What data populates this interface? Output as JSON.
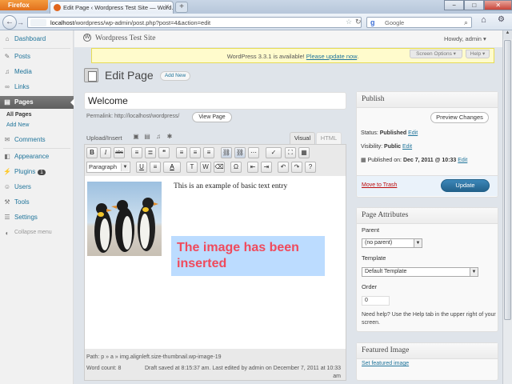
{
  "browser": {
    "menu_button": "Firefox",
    "tab_title": "Edit Page ‹ Wordpress Test Site — Word...",
    "url_host": "localhost",
    "url_path": "/wordpress/wp-admin/post.php?post=4&action=edit",
    "search_placeholder": "Google",
    "search_engine_glyph": "g",
    "win_min": "−",
    "win_max": "□",
    "win_close": "✕",
    "newtab": "+"
  },
  "wp_header": {
    "site_name": "Wordpress Test Site",
    "howdy": "Howdy, admin ▾",
    "update_nag_prefix": "WordPress 3.3.1 is available! ",
    "update_nag_link": "Please update now",
    "update_nag_suffix": ".",
    "screen_options": "Screen Options ▾",
    "help": "Help ▾"
  },
  "menu": {
    "dashboard": "Dashboard",
    "posts": "Posts",
    "media": "Media",
    "links": "Links",
    "pages": "Pages",
    "all_pages": "All Pages",
    "add_new": "Add New",
    "comments": "Comments",
    "appearance": "Appearance",
    "plugins": "Plugins",
    "plugins_badge": "1",
    "users": "Users",
    "tools": "Tools",
    "settings": "Settings",
    "collapse": "Collapse menu"
  },
  "page": {
    "heading": "Edit Page",
    "add_new_button": "Add New",
    "title_value": "Welcome",
    "permalink_label": "Permalink: http://localhost/wordpress/",
    "view_page_button": "View Page",
    "upload_insert_label": "Upload/Insert"
  },
  "editor": {
    "tab_visual": "Visual",
    "tab_html": "HTML",
    "format_select": "Paragraph",
    "body_text": "This is an example of basic text entry",
    "inserted_text": "The image has been inserted",
    "path": "Path: p » a » img.alignleft.size-thumbnail.wp-image-19",
    "word_count": "Word count: 8",
    "draft_saved": "Draft saved at 8:15:37 am. Last edited by admin on December 7, 2011 at 10:33 am"
  },
  "publish": {
    "title": "Publish",
    "preview_button": "Preview Changes",
    "status_label": "Status: ",
    "status_value": "Published",
    "status_edit": "Edit",
    "visibility_label": "Visibility: ",
    "visibility_value": "Public",
    "visibility_edit": "Edit",
    "published_on": "Published on: ",
    "published_date": "Dec 7, 2011 @ 10:33",
    "published_edit": "Edit",
    "trash_link": "Move to Trash",
    "update_button": "Update"
  },
  "page_attributes": {
    "title": "Page Attributes",
    "parent_label": "Parent",
    "parent_value": "(no parent)",
    "template_label": "Template",
    "template_value": "Default Template",
    "order_label": "Order",
    "order_value": "0",
    "help_text": "Need help? Use the Help tab in the upper right of your screen."
  },
  "featured_image": {
    "title": "Featured Image",
    "link": "Set featured image"
  },
  "colors": {
    "link": "#21759b",
    "update_button": "#2a6f9e",
    "inserted_text": "#f04a5c",
    "inserted_bg": "#bcdcff",
    "nag_bg": "#fffbcc"
  },
  "icons": {
    "back": "←",
    "forward": "→",
    "star": "☆",
    "reload": "↻",
    "search": "⌕",
    "home": "⌂",
    "tools": "⚙",
    "dropdown": "▼",
    "up_arrow": "▲"
  },
  "toolbar": {
    "bold": "B",
    "italic": "I",
    "strike": "abc",
    "ul": "≡",
    "ol": "≣",
    "quote": "❝",
    "align_left": "≡",
    "align_center": "≡",
    "align_right": "≡",
    "link": "⛓",
    "unlink": "⛓",
    "more": "⋯",
    "spell": "✓",
    "fullscreen": "⛶",
    "kitchen": "▦",
    "underline": "U",
    "justify": "≡",
    "textcolor": "A",
    "paste_text": "T",
    "paste_word": "W",
    "clear": "⌫",
    "omega": "Ω",
    "outdent": "⇤",
    "indent": "⇥",
    "undo": "↶",
    "redo": "↷",
    "help": "?"
  }
}
